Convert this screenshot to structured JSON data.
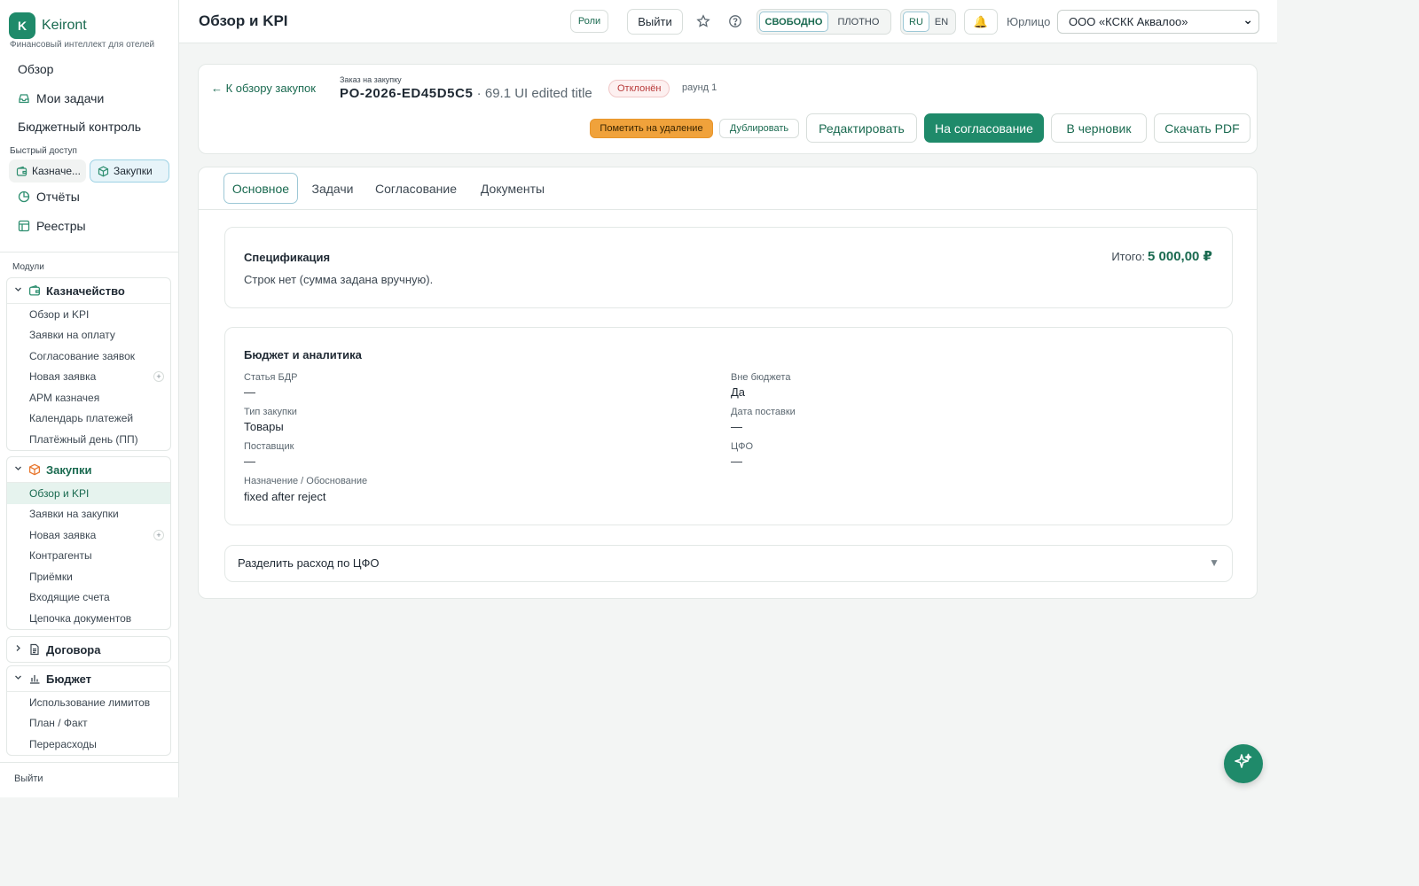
{
  "brand": {
    "letter": "K",
    "name": "Keiront",
    "tagline": "Финансовый интеллект для отелей"
  },
  "sidebar": {
    "nav": {
      "overview": "Обзор",
      "my_tasks": "Мои задачи",
      "budget_control": "Бюджетный контроль",
      "reports": "Отчёты",
      "registries": "Реестры"
    },
    "quick_access_label": "Быстрый доступ",
    "quick_access": [
      "Казначе...",
      "Закупки"
    ],
    "modules_label": "Модули",
    "treasury": {
      "title": "Казначейство",
      "items": [
        "Обзор и KPI",
        "Заявки на оплату",
        "Согласование заявок",
        "Новая заявка",
        "АРМ казначея",
        "Календарь платежей",
        "Платёжный день (ПП)"
      ]
    },
    "procurement": {
      "title": "Закупки",
      "items": [
        "Обзор и KPI",
        "Заявки на закупки",
        "Новая заявка",
        "Контрагенты",
        "Приёмки",
        "Входящие счета",
        "Цепочка документов"
      ]
    },
    "contracts": {
      "title": "Договора"
    },
    "budget": {
      "title": "Бюджет",
      "items": [
        "Использование лимитов",
        "План / Факт",
        "Перерасходы"
      ]
    },
    "plus": "+",
    "logout": "Выйти"
  },
  "topbar": {
    "title": "Обзор и KPI",
    "roles": "Роли",
    "logout": "Выйти",
    "density_free": "СВОБОДНО",
    "density_dense": "ПЛОТНО",
    "lang_ru": "RU",
    "lang_en": "EN",
    "bell": "🔔",
    "entity_label": "Юрлицо",
    "entity_value": "ООО «КСКК Аквалоо»",
    "chevron": "⌄"
  },
  "order": {
    "back": "← К обзору закупок",
    "kicker": "Заказ на закупку",
    "code": "PO-2026-ED45D5C5",
    "title_rest": " · 69.1 UI edited title",
    "status": "Отклонён",
    "round": "раунд 1",
    "actions": {
      "mark_delete": "Пометить на удаление",
      "duplicate": "Дублировать",
      "edit": "Редактировать",
      "to_approval": "На согласование",
      "to_draft": "В черновик",
      "download_pdf": "Скачать PDF"
    }
  },
  "tabs": [
    "Основное",
    "Задачи",
    "Согласование",
    "Документы"
  ],
  "specification": {
    "title": "Спецификация",
    "text": "Строк нет (сумма задана вручную).",
    "total_label": "Итого:",
    "total_value": "5 000,00 ₽"
  },
  "budget_analytics": {
    "title": "Бюджет и аналитика",
    "fields": {
      "bdr_article": {
        "label": "Статья БДР",
        "value": "—"
      },
      "off_budget": {
        "label": "Вне бюджета",
        "value": "Да"
      },
      "purchase_type": {
        "label": "Тип закупки",
        "value": "Товары"
      },
      "delivery_date": {
        "label": "Дата поставки",
        "value": "—"
      },
      "supplier": {
        "label": "Поставщик",
        "value": "—"
      },
      "cfo": {
        "label": "ЦФО",
        "value": "—"
      },
      "purpose": {
        "label": "Назначение / Обоснование",
        "value": "fixed after reject"
      }
    }
  },
  "split": {
    "title": "Разделить расход по ЦФО",
    "arrow": "▼"
  },
  "colors": {
    "accent": "#1f8a6a",
    "accent_text": "#1a6a50",
    "warning": "#f0a23b",
    "danger": "#b83a3a"
  },
  "icons": {
    "inbox": "inbox-icon",
    "star": "star-icon",
    "help": "help-icon",
    "sparkle": "sparkle-icon"
  }
}
